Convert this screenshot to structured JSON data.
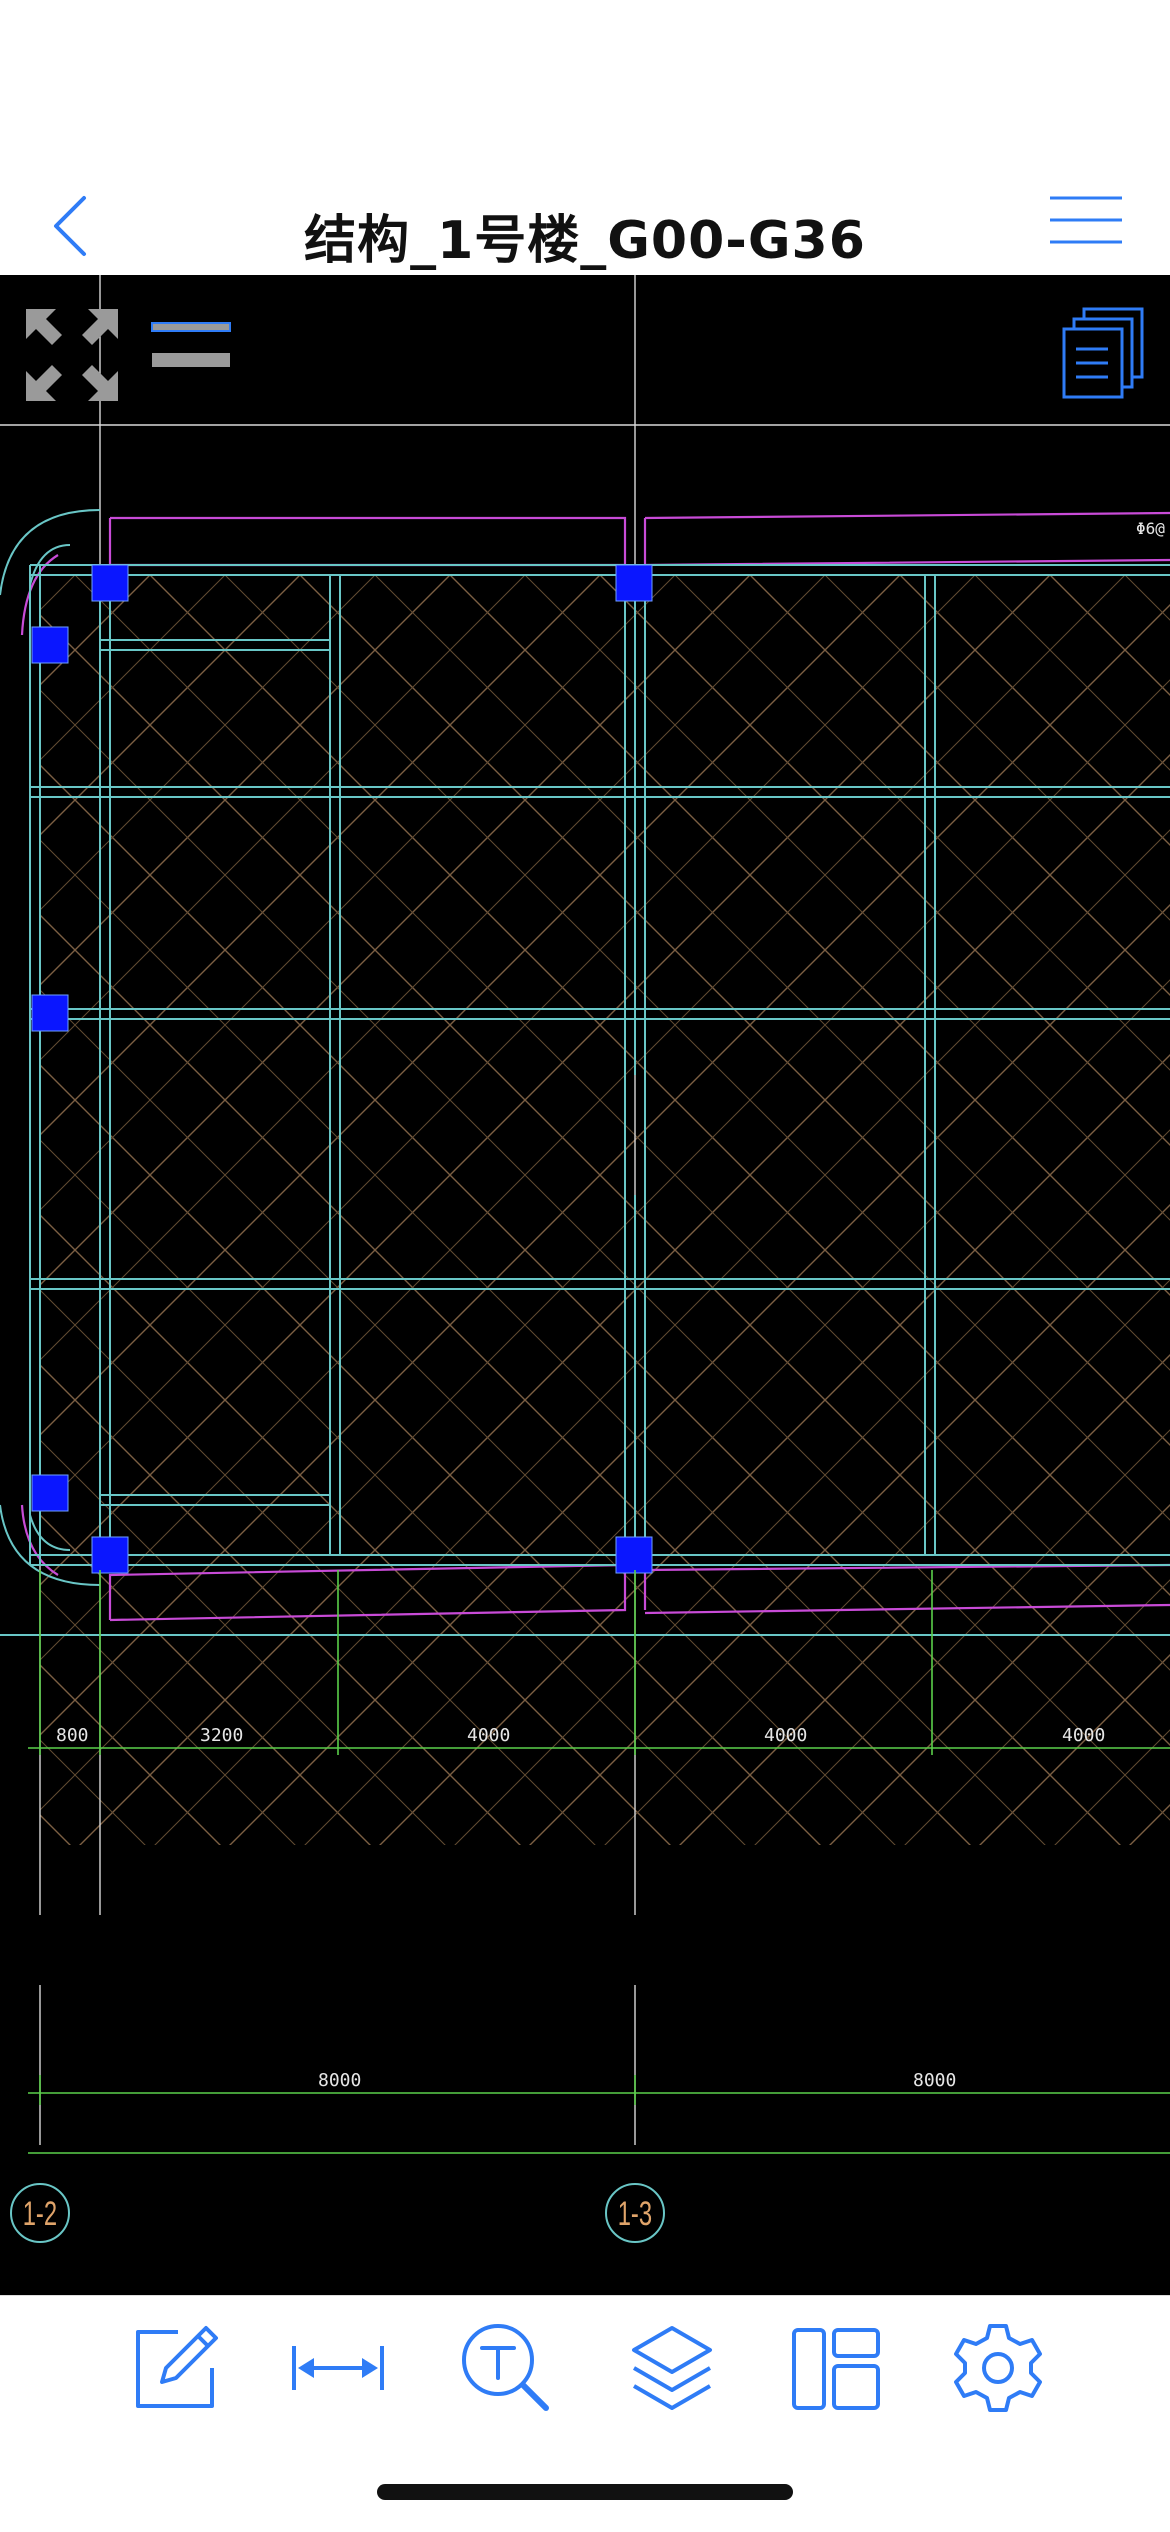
{
  "header": {
    "title": "结构_1号楼_G00-G36",
    "back_icon": "chevron-left-icon",
    "menu_icon": "hamburger-menu-icon"
  },
  "canvas_tools": {
    "fullscreen_icon": "expand-arrows-icon",
    "lineweight_icon": "line-weight-icon",
    "layouts_icon": "stacked-sheets-icon"
  },
  "drawing": {
    "annotation": "Φ6@",
    "dimensions_row1": [
      "800",
      "3200",
      "4000",
      "4000",
      "4000"
    ],
    "dimensions_row2": [
      "8000",
      "8000"
    ],
    "axis_labels": [
      "1-2",
      "1-3"
    ]
  },
  "toolbar": {
    "items": [
      {
        "name": "annotate-button",
        "icon": "edit-pencil-icon"
      },
      {
        "name": "measure-button",
        "icon": "measure-arrows-icon"
      },
      {
        "name": "text-search-button",
        "icon": "text-search-icon"
      },
      {
        "name": "layers-button",
        "icon": "layers-icon"
      },
      {
        "name": "layout-button",
        "icon": "layout-panels-icon"
      },
      {
        "name": "settings-button",
        "icon": "settings-gear-icon"
      }
    ]
  },
  "colors": {
    "accent": "#2f7cf6",
    "canvas": "#000000",
    "column_fill": "#0a16ff",
    "cyan_line": "#69c6c6",
    "magenta_line": "#c84bd7",
    "hatch_line": "#8a6a4a",
    "dim_line": "#5bcf4a"
  }
}
